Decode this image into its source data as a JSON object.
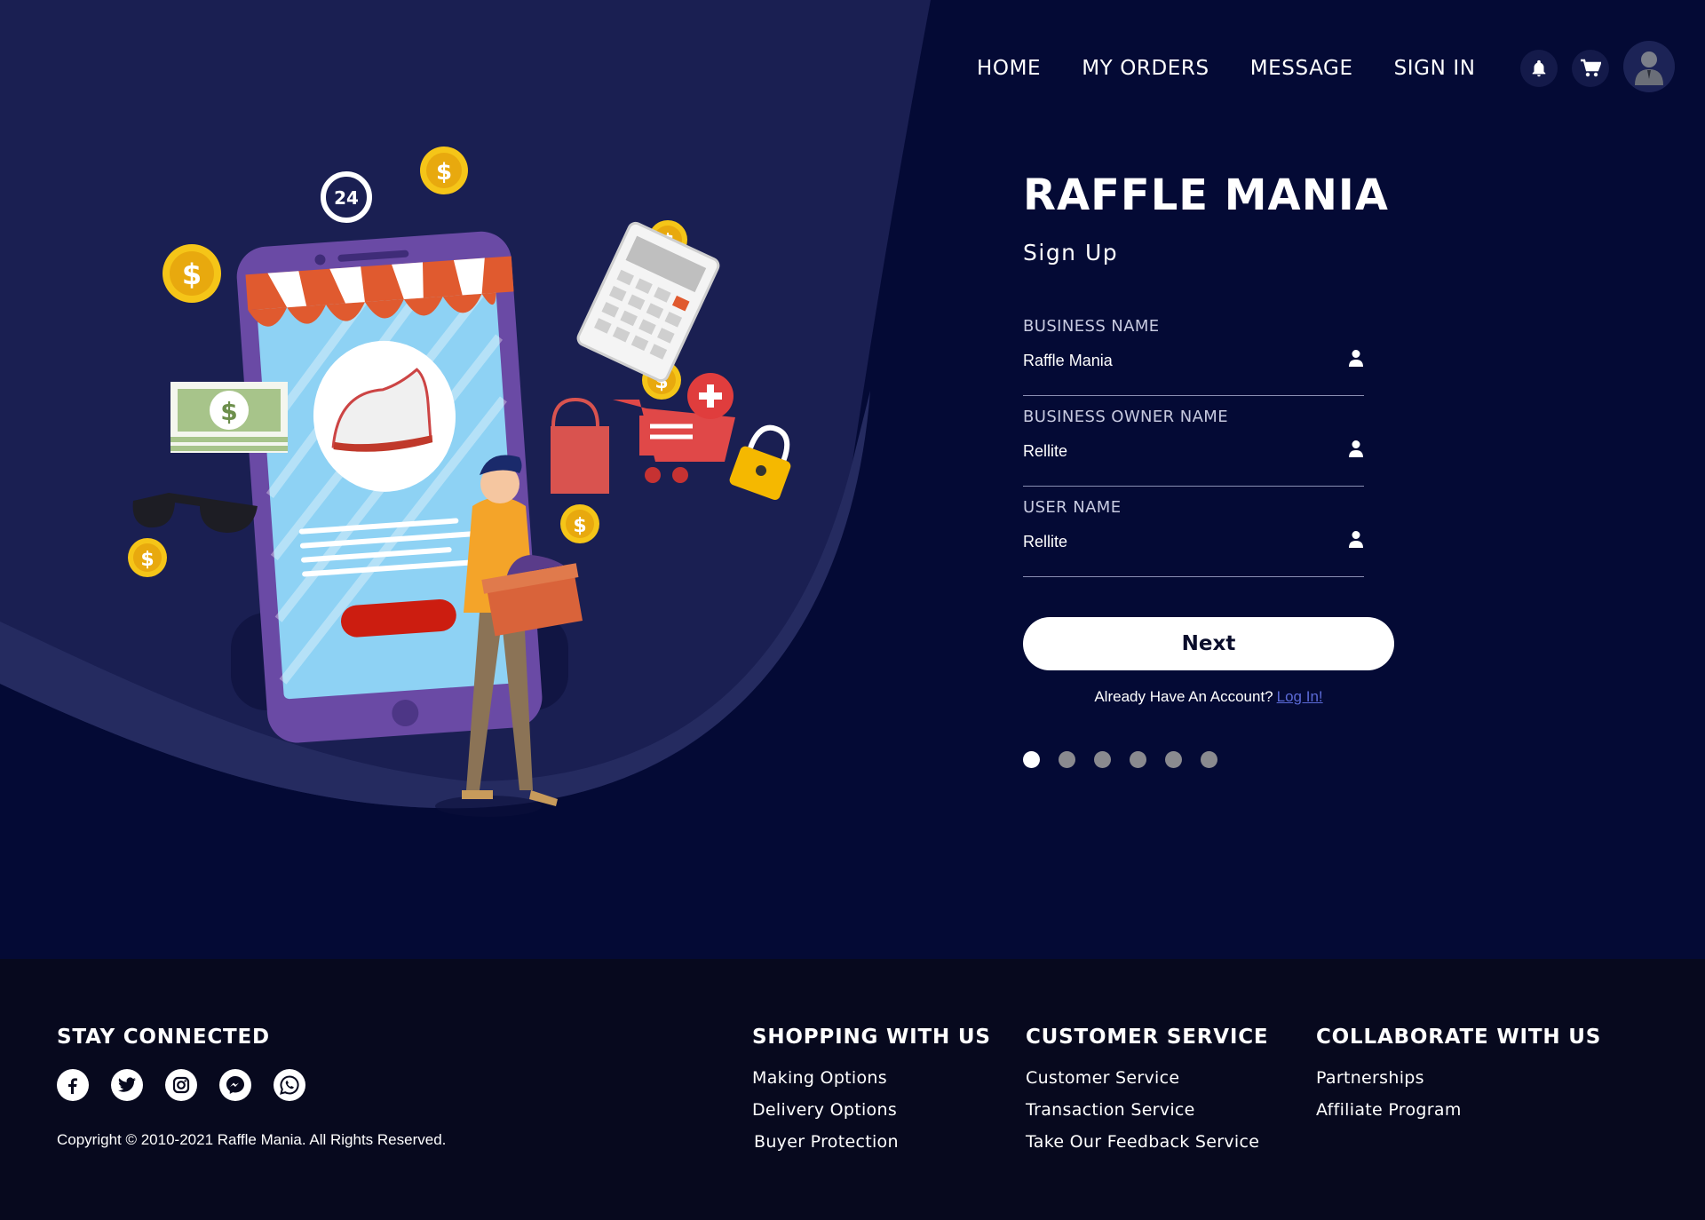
{
  "nav": {
    "items": [
      "HOME",
      "MY ORDERS",
      "MESSAGE",
      "SIGN IN"
    ],
    "icons": [
      "bell-icon",
      "cart-icon",
      "user-avatar"
    ]
  },
  "form": {
    "brand": "RAFFLE MANIA",
    "subtitle": "Sign Up",
    "fields": [
      {
        "label": "BUSINESS NAME",
        "value": "Raffle Mania"
      },
      {
        "label": "BUSINESS OWNER NAME",
        "value": "Rellite"
      },
      {
        "label": "USER NAME",
        "value": "Rellite"
      }
    ],
    "next_label": "Next",
    "already_text": "Already Have An Account?",
    "login_link": "Log In!",
    "steps_total": 6,
    "steps_current": 1
  },
  "illustration": {
    "badge_24": "24",
    "coin_symbol": "$"
  },
  "footer": {
    "stay_connected": "STAY CONNECTED",
    "social": [
      "facebook-icon",
      "twitter-icon",
      "instagram-icon",
      "messenger-icon",
      "whatsapp-icon"
    ],
    "copyright": "Copyright © 2010-2021 Raffle Mania. All Rights Reserved.",
    "columns": [
      {
        "title": "SHOPPING WITH US",
        "links": [
          "Making Options",
          "Delivery Options",
          "Buyer Protection"
        ]
      },
      {
        "title": "CUSTOMER SERVICE",
        "links": [
          "Customer Service",
          "Transaction Service",
          "Take Our Feedback Service"
        ]
      },
      {
        "title": "COLLABORATE WITH US",
        "links": [
          "Partnerships",
          "Affiliate Program"
        ]
      }
    ]
  },
  "colors": {
    "hero_bg": "#040a35",
    "wave": "#1a1f52",
    "footer_bg": "#07091e",
    "link": "#5b6ad7"
  }
}
